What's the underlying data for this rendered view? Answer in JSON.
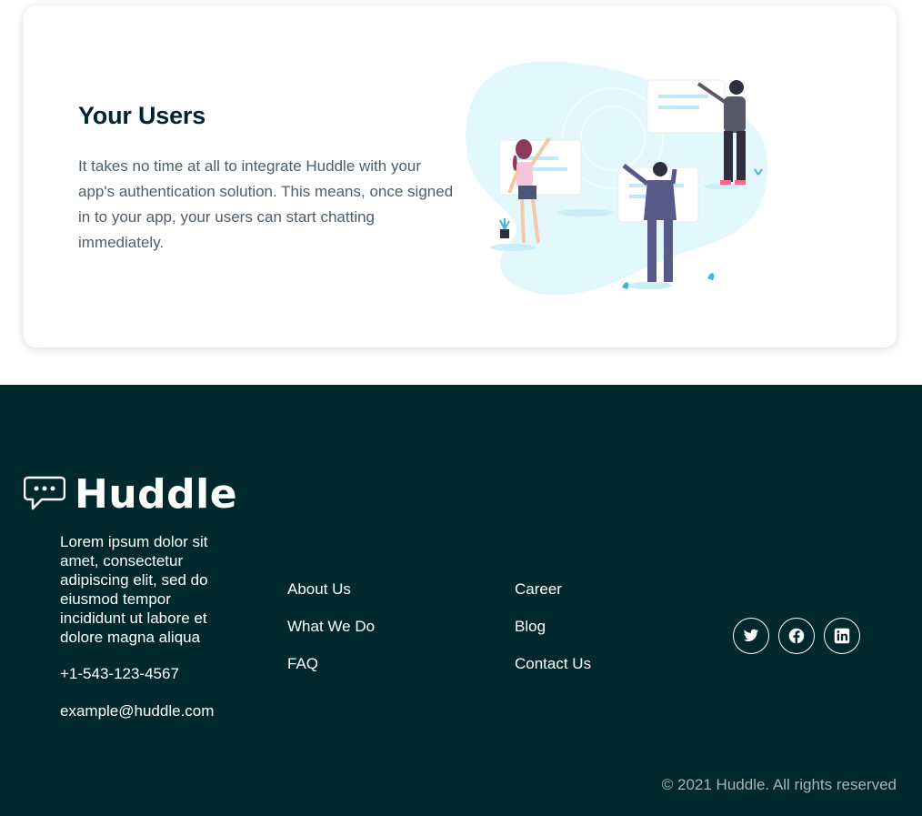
{
  "card": {
    "title": "Your Users",
    "text": "It takes no time at all to integrate Huddle with your app's authentication solution. This means, once signed in to your app, your users can start chatting immediately."
  },
  "footer": {
    "brand": "Huddle",
    "description": "Lorem ipsum dolor sit amet, consectetur adipiscing elit, sed do eiusmod tempor incididunt ut labore et dolore magna aliqua",
    "phone": "+1-543-123-4567",
    "email": "example@huddle.com",
    "links_col1": [
      "About Us",
      "What We Do",
      "FAQ"
    ],
    "links_col2": [
      "Career",
      "Blog",
      "Contact Us"
    ],
    "socials": [
      "twitter-icon",
      "facebook-icon",
      "linkedin-icon"
    ],
    "copyright": "© 2021 Huddle. All rights reserved"
  },
  "colors": {
    "dark_teal": "#00292e",
    "heading": "#00252e",
    "body_text": "#4d5e6a",
    "accent_blob": "#e3f8fd"
  }
}
